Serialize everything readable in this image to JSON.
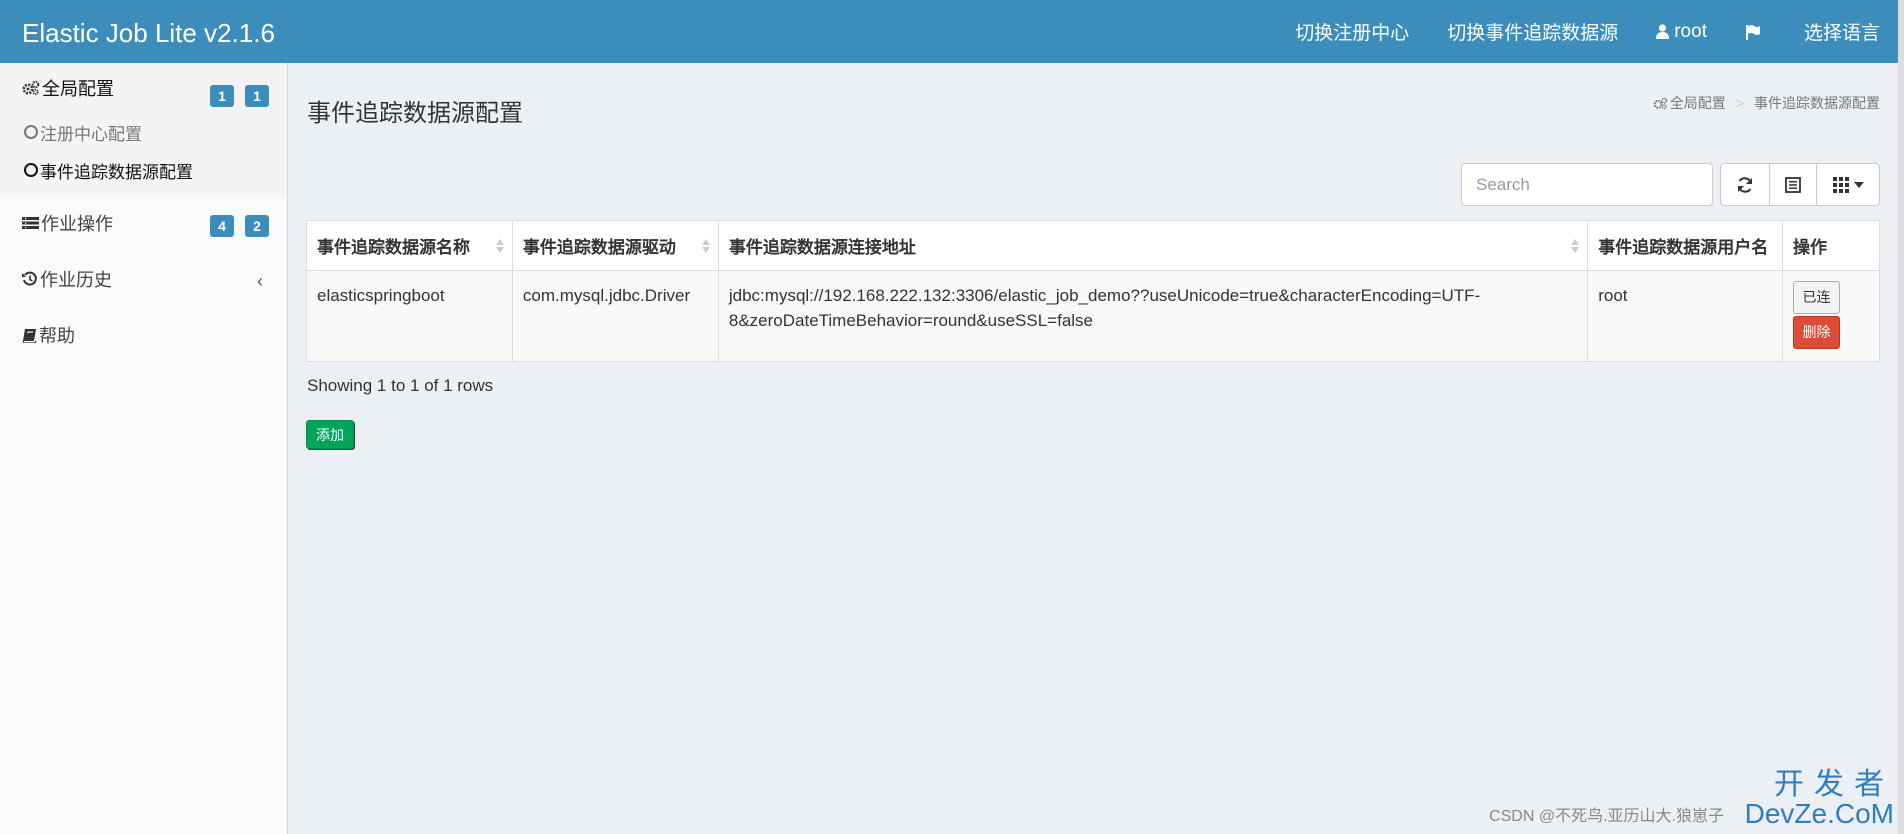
{
  "header": {
    "logo": "Elastic Job Lite v2.1.6",
    "nav": {
      "switch_registry": "切换注册中心",
      "switch_datasource": "切换事件追踪数据源",
      "user": "root",
      "language": "选择语言"
    },
    "color": "#3c8dbc"
  },
  "sidebar": {
    "global_config": {
      "label": "全局配置",
      "badge1": "1",
      "badge2": "1"
    },
    "registry_config": "注册中心配置",
    "datasource_config": "事件追踪数据源配置",
    "job_ops": {
      "label": "作业操作",
      "badge1": "4",
      "badge2": "2"
    },
    "job_history": "作业历史",
    "help": "帮助"
  },
  "main": {
    "title": "事件追踪数据源配置",
    "breadcrumb": {
      "root": "全局配置",
      "current": "事件追踪数据源配置"
    },
    "search_placeholder": "Search",
    "table": {
      "headers": [
        "事件追踪数据源名称",
        "事件追踪数据源驱动",
        "事件追踪数据源连接地址",
        "事件追踪数据源用户名",
        "操作"
      ],
      "rows": [
        {
          "name": "elasticspringboot",
          "driver": "com.mysql.jdbc.Driver",
          "url_line1": "jdbc:mysql://192.168.222.132:3306/elastic_job_demo??useUnicode=true&characterEncoding=UTF-",
          "url_line2": "8&zeroDateTimeBehavior=round&useSSL=false",
          "username": "root",
          "connected_label": "已连",
          "delete_label": "删除"
        }
      ]
    },
    "rows_info": "Showing 1 to 1 of 1 rows",
    "add_label": "添加"
  },
  "watermark": {
    "small": "CSDN @不死鸟.亚历山大.狼崽子",
    "big1": "开发者",
    "big2": "DevZe.CoM"
  }
}
